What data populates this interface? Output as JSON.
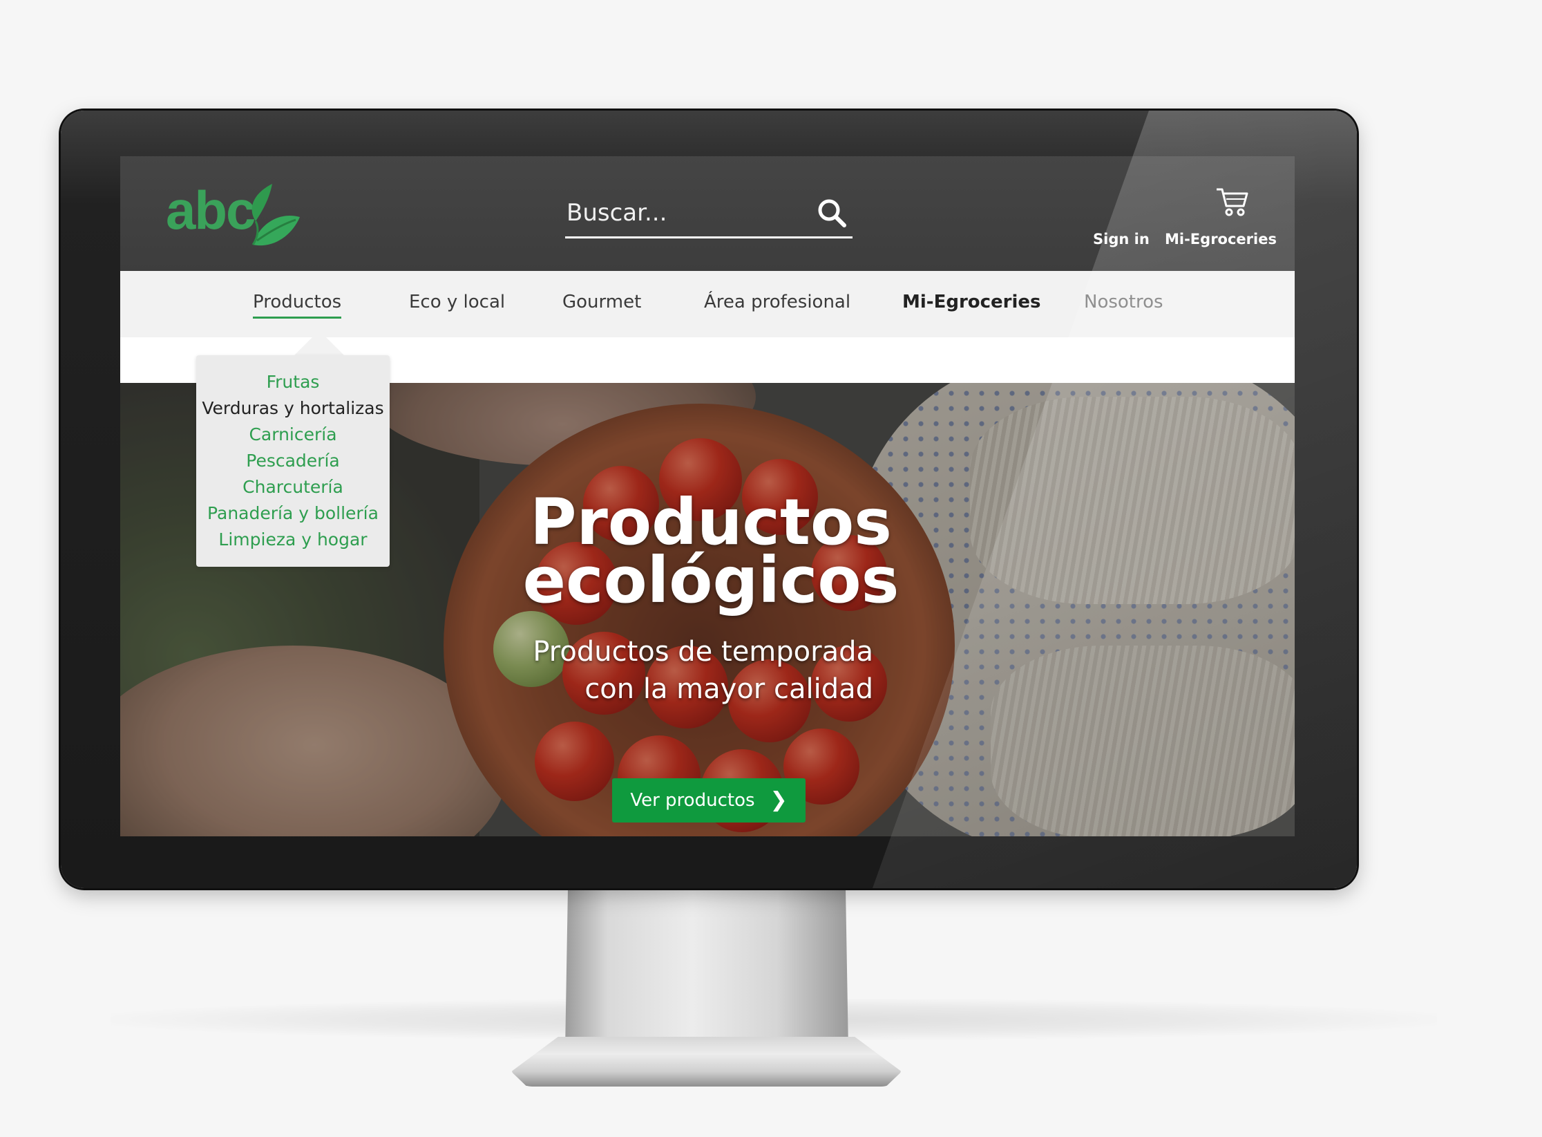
{
  "header": {
    "logo_text": "abc",
    "search_placeholder": "Buscar...",
    "sign_in_label": "Sign in",
    "account_label": "Mi-Egroceries",
    "cart_icon": "cart-icon",
    "search_icon": "search-icon"
  },
  "nav": {
    "items": [
      {
        "label": "Productos"
      },
      {
        "label": "Eco y local"
      },
      {
        "label": "Gourmet"
      },
      {
        "label": "Área profesional"
      },
      {
        "label": "Mi-Egroceries"
      },
      {
        "label": "Nosotros"
      }
    ],
    "active": "Productos"
  },
  "dropdown": {
    "items": [
      {
        "label": "Frutas"
      },
      {
        "label": "Verduras y hortalizas"
      },
      {
        "label": "Carnicería"
      },
      {
        "label": "Pescadería"
      },
      {
        "label": "Charcutería"
      },
      {
        "label": "Panadería y bollería"
      },
      {
        "label": "Limpieza y hogar"
      }
    ],
    "hovered": "Verduras y hortalizas"
  },
  "hero": {
    "title_line1": "Productos",
    "title_line2": "ecológicos",
    "subtitle_line1": "Productos de temporada",
    "subtitle_line2": "con la mayor calidad",
    "cta_label": "Ver productos",
    "cta_icon": "chevron-right-icon"
  },
  "colors": {
    "brand_green": "#2e9e4f",
    "cta_green": "#0f9a3e",
    "header_bg": "#414141",
    "nav_bg": "#f2f2f2"
  }
}
